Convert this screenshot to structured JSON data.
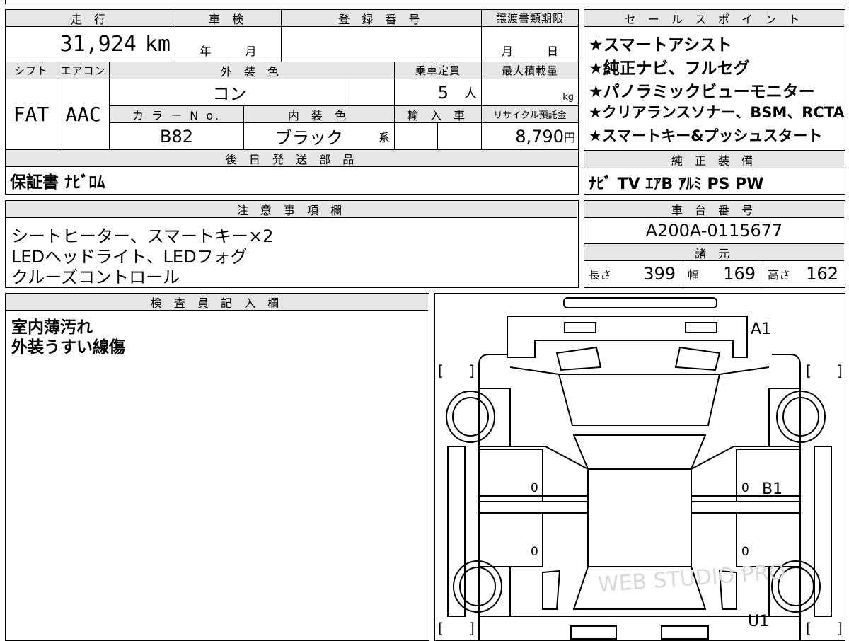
{
  "main_info": {
    "mileage_header": "走 行",
    "mileage_value": "31,924",
    "mileage_unit": "km",
    "inspection_header": "車 検",
    "inspection_year": "年",
    "inspection_month": "月",
    "registration_header": "登 録 番 号",
    "registration_value": "",
    "transfer_header": "譲渡書類期限",
    "transfer_month": "月",
    "transfer_day": "日",
    "shift_header": "シフト",
    "shift_value": "FAT",
    "aircon_header": "エアコン",
    "aircon_value": "AAC",
    "exterior_header": "外 装 色",
    "exterior_value": "コン",
    "capacity_header": "乗車定員",
    "capacity_value": "5",
    "capacity_unit": "人",
    "load_header": "最大積載量",
    "load_unit": "kg",
    "color_no_header": "カ ラ ー N o.",
    "color_no_value": "B82",
    "interior_header": "内 装 色",
    "interior_value": "ブラック",
    "interior_suffix": "系",
    "import_header": "輸 入 車",
    "recycle_header": "リサイクル預託金",
    "recycle_value": "8,790",
    "recycle_unit": "円",
    "later_parts_header": "後 日 発 送 部 品",
    "later_parts_value": "保証書 ﾅﾋﾞﾛﾑ"
  },
  "sales_points": {
    "header": "セ ー ル ス ポ イ ン ト",
    "items": [
      "★スマートアシスト",
      "★純正ナビ、フルセグ",
      "★パノラミックビューモニター",
      "★クリアランスソナー、BSM、RCTA",
      "★スマートキー&プッシュスタート"
    ]
  },
  "factory_equipment": {
    "header": "純 正 装 備",
    "value": "ﾅﾋﾞ TV ｴｱB ｱﾙﾐ PS PW"
  },
  "notes": {
    "header": "注 意 事 項 欄",
    "lines": [
      "シートヒーター、スマートキー×2",
      "LEDヘッドライト、LEDフォグ",
      "クルーズコントロール"
    ]
  },
  "chassis": {
    "header": "車 台 番 号",
    "value": "A200A-0115677"
  },
  "specs": {
    "header": "諸 元",
    "length_label": "長さ",
    "length_value": "399",
    "width_label": "幅",
    "width_value": "169",
    "height_label": "高さ",
    "height_value": "162"
  },
  "inspector": {
    "header": "検 査 員 記 入 欄",
    "lines": [
      "室内薄汚れ",
      "外装うすい線傷"
    ]
  },
  "diagram": {
    "marks": [
      "A1",
      "B1",
      "U1"
    ],
    "zero_labels": [
      "0",
      "0",
      "0",
      "0"
    ],
    "bracket_left": "[",
    "bracket_right": "]",
    "watermark": "WEB STUDIO PRO"
  }
}
